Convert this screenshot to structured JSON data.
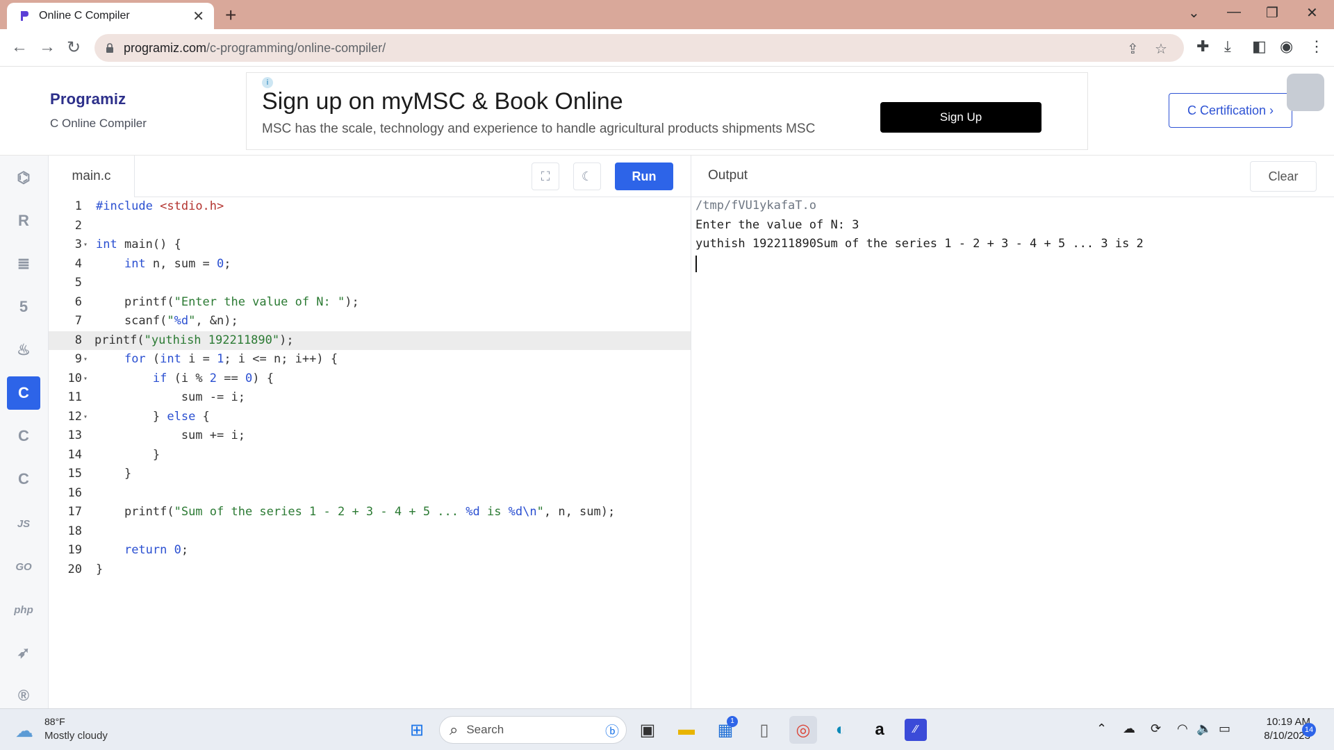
{
  "browser": {
    "tab_title": "Online C Compiler",
    "url_domain": "programiz.com",
    "url_path": "/c-programming/online-compiler/"
  },
  "site": {
    "brand_name": "Programiz",
    "brand_subtitle": "C Online Compiler",
    "ad_title": "Sign up on myMSC & Book Online",
    "ad_description": "MSC has the scale, technology and experience to handle agricultural products shipments MSC",
    "ad_button": "Sign Up",
    "cert_button": "C Certification ›"
  },
  "rail": {
    "items": [
      "python-icon",
      "r-icon",
      "sql-icon",
      "html-icon",
      "java-icon",
      "c-icon",
      "cpp-icon",
      "csharp-icon",
      "JS",
      "GO",
      "php",
      "swift-icon",
      "rust-icon"
    ]
  },
  "editor": {
    "file_name": "main.c",
    "run_label": "Run",
    "lines": [
      "#include <stdio.h>",
      "",
      "int main() {",
      "    int n, sum = 0;",
      "",
      "    printf(\"Enter the value of N: \");",
      "    scanf(\"%d\", &n);",
      "printf(\"yuthish 192211890\");",
      "    for (int i = 1; i <= n; i++) {",
      "        if (i % 2 == 0) {",
      "            sum -= i;",
      "        } else {",
      "            sum += i;",
      "        }",
      "    }",
      "",
      "    printf(\"Sum of the series 1 - 2 + 3 - 4 + 5 ... %d is %d\\n\", n, sum);",
      "",
      "    return 0;",
      "}"
    ],
    "line_numbers": [
      "1",
      "2",
      "3",
      "4",
      "5",
      "6",
      "7",
      "8",
      "9",
      "10",
      "11",
      "12",
      "13",
      "14",
      "15",
      "16",
      "17",
      "18",
      "19",
      "20"
    ],
    "active_line": 8
  },
  "output": {
    "title": "Output",
    "clear_label": "Clear",
    "lines": [
      "/tmp/fVU1ykafaT.o",
      "Enter the value of N: 3",
      "yuthish 192211890Sum of the series 1 - 2 + 3 - 4 + 5 ... 3 is 2"
    ]
  },
  "taskbar": {
    "temperature": "88°F",
    "weather": "Mostly cloudy",
    "search_placeholder": "Search",
    "time": "10:19 AM",
    "date": "8/10/2023",
    "notification_count": "14",
    "store_badge": "1"
  },
  "colors": {
    "tabbar": "#d9a89a",
    "accent": "#2d64e8",
    "brand": "#2c2f8a"
  }
}
